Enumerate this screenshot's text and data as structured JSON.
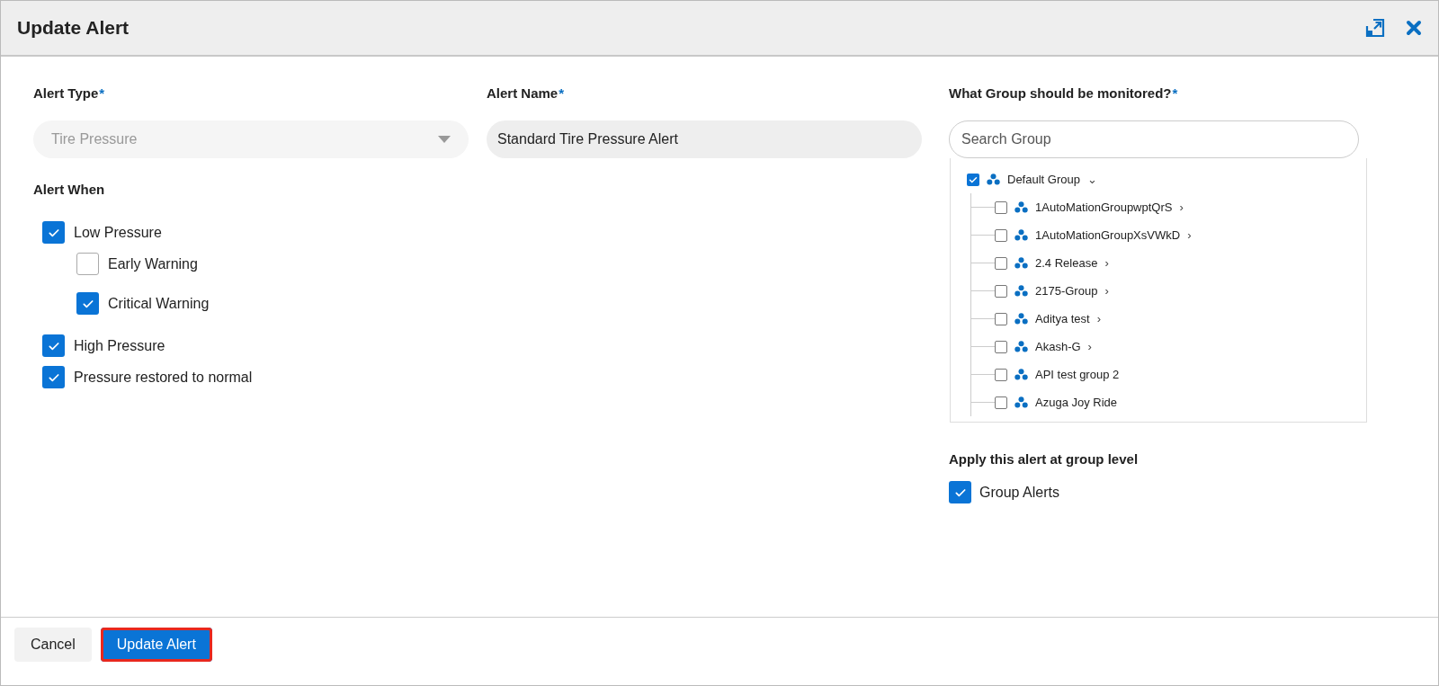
{
  "dialog": {
    "title": "Update Alert"
  },
  "alert_type": {
    "label": "Alert Type",
    "required_mark": "*",
    "value": "Tire Pressure",
    "disabled": true
  },
  "alert_name": {
    "label": "Alert Name",
    "required_mark": "*",
    "value": "Standard Tire Pressure Alert"
  },
  "alert_when": {
    "label": "Alert When",
    "options": [
      {
        "label": "Low Pressure",
        "checked": true,
        "children": [
          {
            "label": "Early Warning",
            "checked": false
          },
          {
            "label": "Critical Warning",
            "checked": true
          }
        ]
      },
      {
        "label": "High Pressure",
        "checked": true
      },
      {
        "label": "Pressure restored to normal",
        "checked": true
      }
    ]
  },
  "group": {
    "label": "What Group should be monitored?",
    "required_mark": "*",
    "search": {
      "placeholder": "Search Group"
    },
    "tree": [
      {
        "label": "Default Group",
        "checked": true,
        "toggle": "⌄",
        "children": [
          {
            "label": "1AutoMationGroupwptQrS",
            "checked": false,
            "toggle": "›"
          },
          {
            "label": "1AutoMationGroupXsVWkD",
            "checked": false,
            "toggle": "›"
          },
          {
            "label": "2.4 Release",
            "checked": false,
            "toggle": "›"
          },
          {
            "label": "2175-Group",
            "checked": false,
            "toggle": "›"
          },
          {
            "label": "Aditya test",
            "checked": false,
            "toggle": "›"
          },
          {
            "label": "Akash-G",
            "checked": false,
            "toggle": "›"
          },
          {
            "label": "API test group 2",
            "checked": false
          },
          {
            "label": "Azuga Joy Ride",
            "checked": false
          }
        ]
      }
    ]
  },
  "group_level": {
    "label": "Apply this alert at group level",
    "option": {
      "label": "Group Alerts",
      "checked": true
    }
  },
  "buttons": [
    {
      "label": "Cancel",
      "kind": "secondary",
      "highlighted": false
    },
    {
      "label": "Update Alert",
      "kind": "primary",
      "highlighted": true
    }
  ]
}
